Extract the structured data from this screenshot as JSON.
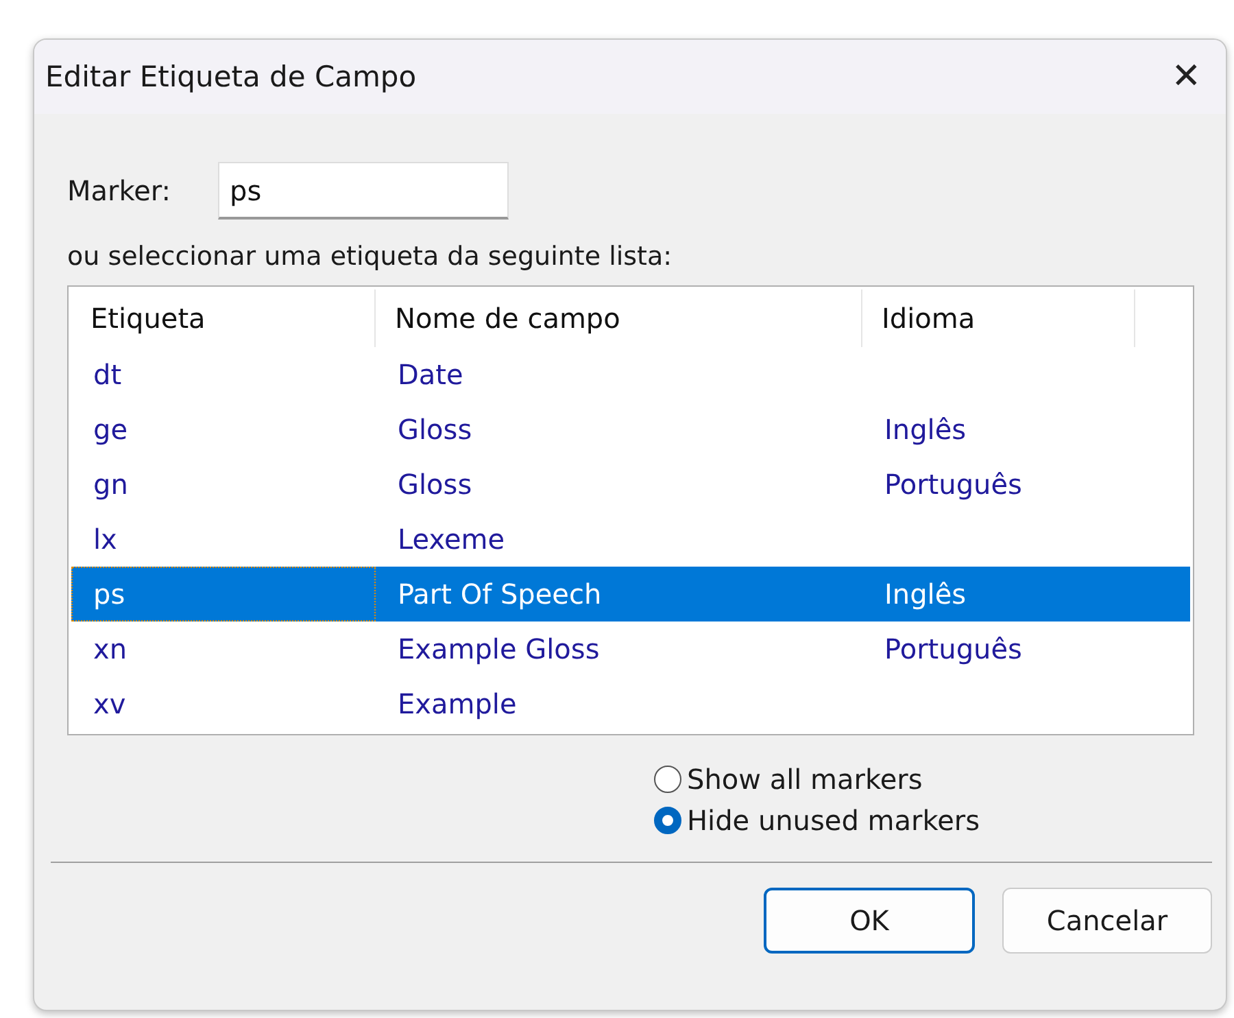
{
  "window": {
    "title": "Editar Etiqueta de Campo",
    "close": "✕"
  },
  "marker": {
    "label": "Marker:",
    "value": "ps"
  },
  "list_caption": "ou seleccionar uma etiqueta da seguinte lista:",
  "table": {
    "columns": [
      "Etiqueta",
      "Nome de campo",
      "Idioma"
    ],
    "rows": [
      {
        "cells": [
          "dt",
          "Date",
          ""
        ],
        "selected": false
      },
      {
        "cells": [
          "ge",
          "Gloss",
          "Inglês"
        ],
        "selected": false
      },
      {
        "cells": [
          "gn",
          "Gloss",
          "Português"
        ],
        "selected": false
      },
      {
        "cells": [
          "lx",
          "Lexeme",
          ""
        ],
        "selected": false
      },
      {
        "cells": [
          "ps",
          "Part Of Speech",
          "Inglês"
        ],
        "selected": true
      },
      {
        "cells": [
          "xn",
          "Example Gloss",
          "Português"
        ],
        "selected": false
      },
      {
        "cells": [
          "xv",
          "Example",
          ""
        ],
        "selected": false
      }
    ]
  },
  "options": [
    {
      "label": "Show all markers",
      "selected": false
    },
    {
      "label": "Hide unused markers",
      "selected": true
    }
  ],
  "buttons": [
    {
      "label": "OK",
      "default": true
    },
    {
      "label": "Cancelar",
      "default": false
    }
  ]
}
